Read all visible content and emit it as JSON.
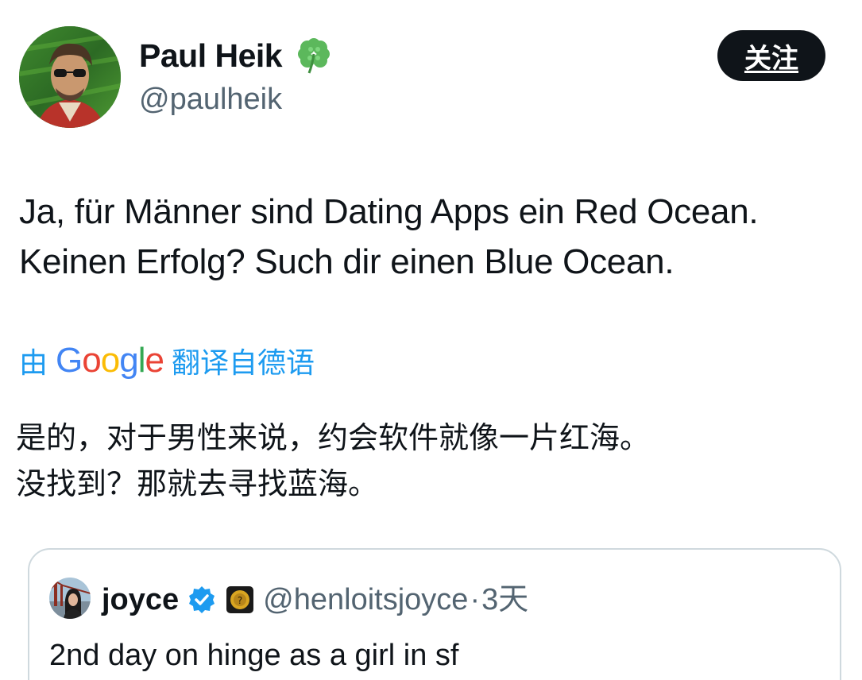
{
  "author": {
    "name": "Paul Heik",
    "handle": "@paulheik",
    "emoji_icon": "four-leaf-clover-icon"
  },
  "follow_button": {
    "label": "关注"
  },
  "tweet": {
    "lines": [
      "Ja, für Männer sind Dating Apps ein Red Ocean.",
      "Keinen Erfolg? Such dir einen Blue Ocean."
    ]
  },
  "translation": {
    "prefix": "由",
    "provider": "Google",
    "suffix": "翻译自德语",
    "lines": [
      "是的，对于男性来说，约会软件就像一片红海。",
      "没找到？那就去寻找蓝海。"
    ]
  },
  "quote": {
    "name": "joyce",
    "handle": "@henloitsjoyce",
    "separator": "·",
    "time": "3天",
    "text": "2nd day on hinge as a girl in sf"
  },
  "colors": {
    "accent_blue": "#1d9bf0",
    "text_primary": "#0f1419",
    "text_secondary": "#536471",
    "border": "#cfd9de"
  }
}
